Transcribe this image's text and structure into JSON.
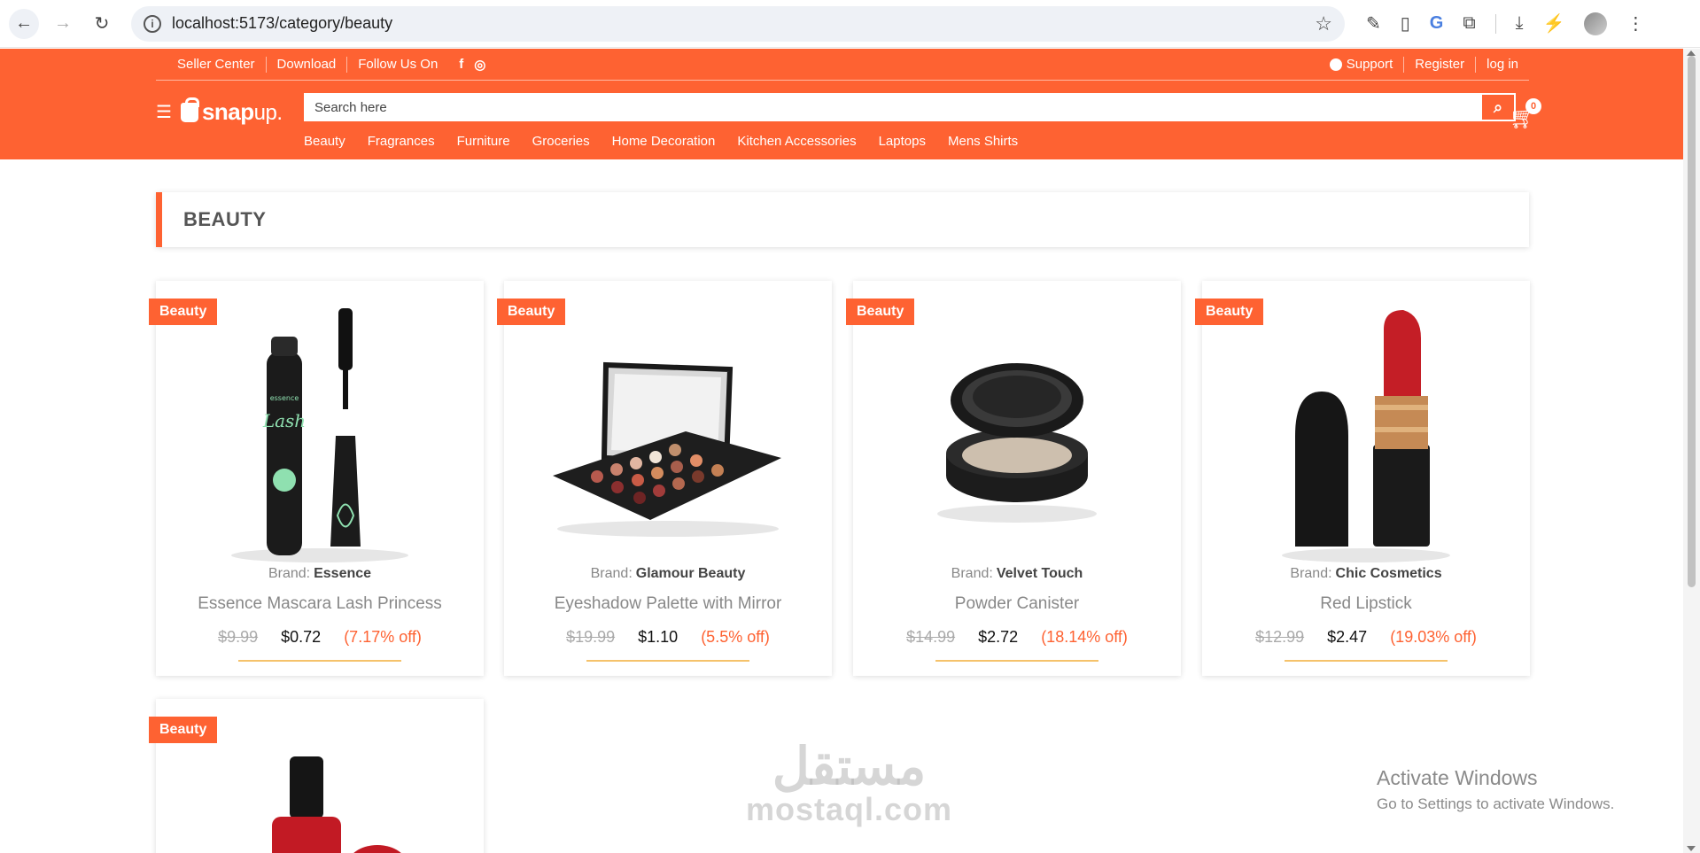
{
  "browser": {
    "url": "localhost:5173/category/beauty"
  },
  "topbar": {
    "seller_center": "Seller Center",
    "download": "Download",
    "follow_us": "Follow Us On",
    "support": "Support",
    "register": "Register",
    "login": "log in"
  },
  "logo": {
    "text_main": "snap",
    "text_suffix": "up."
  },
  "search": {
    "placeholder": "Search here"
  },
  "cart": {
    "count": "0"
  },
  "categories": [
    "Beauty",
    "Fragrances",
    "Furniture",
    "Groceries",
    "Home Decoration",
    "Kitchen Accessories",
    "Laptops",
    "Mens Shirts"
  ],
  "page": {
    "title": "BEAUTY"
  },
  "products": [
    {
      "tag": "Beauty",
      "brand_label": "Brand:",
      "brand": "Essence",
      "name": "Essence Mascara Lash Princess",
      "old_price": "$9.99",
      "price": "$0.72",
      "discount": "(7.17% off)"
    },
    {
      "tag": "Beauty",
      "brand_label": "Brand:",
      "brand": "Glamour Beauty",
      "name": "Eyeshadow Palette with Mirror",
      "old_price": "$19.99",
      "price": "$1.10",
      "discount": "(5.5% off)"
    },
    {
      "tag": "Beauty",
      "brand_label": "Brand:",
      "brand": "Velvet Touch",
      "name": "Powder Canister",
      "old_price": "$14.99",
      "price": "$2.72",
      "discount": "(18.14% off)"
    },
    {
      "tag": "Beauty",
      "brand_label": "Brand:",
      "brand": "Chic Cosmetics",
      "name": "Red Lipstick",
      "old_price": "$12.99",
      "price": "$2.47",
      "discount": "(19.03% off)"
    },
    {
      "tag": "Beauty"
    }
  ],
  "watermark": {
    "arabic": "مستقل",
    "latin": "mostaql.com"
  },
  "windows": {
    "title": "Activate Windows",
    "subtitle": "Go to Settings to activate Windows."
  },
  "colors": {
    "brand": "#fe6232",
    "price_underline": "#f5c26b"
  }
}
